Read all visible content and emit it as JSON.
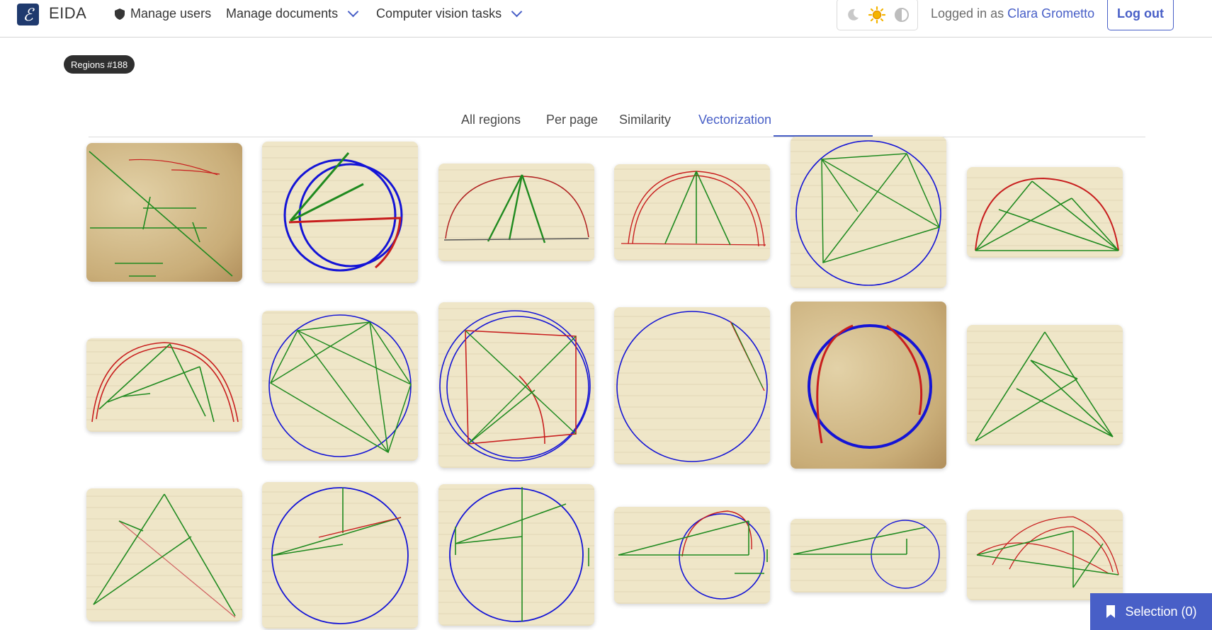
{
  "brand": {
    "logo_glyph": "ℰ",
    "name": "EIDA"
  },
  "nav": {
    "manage_users": "Manage users",
    "manage_documents": "Manage documents",
    "cv_tasks": "Computer vision tasks"
  },
  "theme": {
    "icons": [
      "moon-icon",
      "sun-icon",
      "contrast-icon"
    ],
    "active": "sun-icon"
  },
  "user": {
    "prefix": "Logged in as",
    "name": "Clara Grometto",
    "logout": "Log out"
  },
  "tag": "Regions #188",
  "tabs": [
    {
      "label": "All regions",
      "active": false
    },
    {
      "label": "Per page",
      "active": false
    },
    {
      "label": "Similarity",
      "active": false
    },
    {
      "label": "Vectorization",
      "active": true
    }
  ],
  "selection": {
    "label": "Selection (0)"
  },
  "colors": {
    "accent": "#485fc7",
    "green_line": "#1f8a1f",
    "red_arc": "#c81e1e",
    "blue_circle": "#1414d6"
  }
}
